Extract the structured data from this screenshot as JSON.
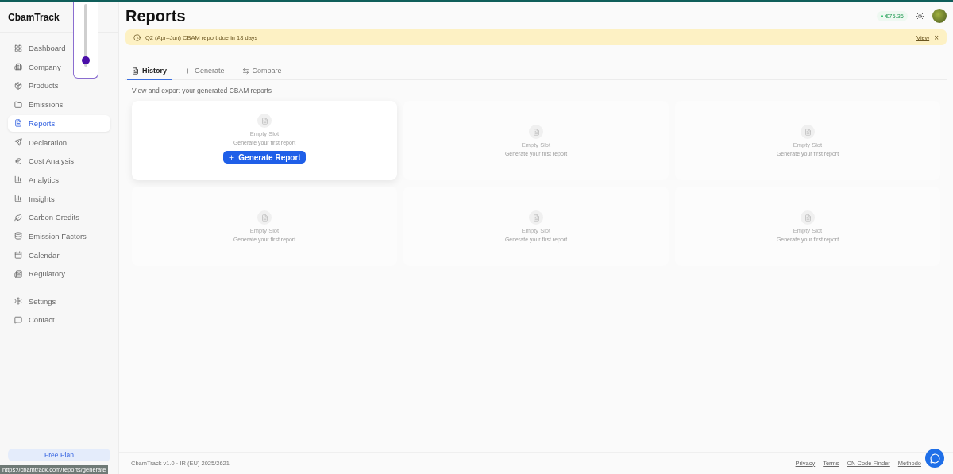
{
  "sidebar": {
    "brand": "CbamTrack",
    "items": [
      {
        "label": "Dashboard",
        "selected": false
      },
      {
        "label": "Company",
        "selected": false
      },
      {
        "label": "Products",
        "selected": false
      },
      {
        "label": "Emissions",
        "selected": false
      },
      {
        "label": "Reports",
        "selected": true
      },
      {
        "label": "Declaration",
        "selected": false
      },
      {
        "label": "Cost Analysis",
        "selected": false
      },
      {
        "label": "Analytics",
        "selected": false
      },
      {
        "label": "Insights",
        "selected": false
      },
      {
        "label": "Carbon Credits",
        "selected": false
      },
      {
        "label": "Emission Factors",
        "selected": false
      },
      {
        "label": "Calendar",
        "selected": false
      },
      {
        "label": "Regulatory",
        "selected": false
      }
    ],
    "bottom_items": [
      {
        "label": "Settings",
        "selected": false
      },
      {
        "label": "Contact",
        "selected": false
      }
    ],
    "plan_button": "Free Plan"
  },
  "overlay_slider": {
    "level": 0.1
  },
  "header": {
    "title": "Reports",
    "balance": "€75.36"
  },
  "banner": {
    "text": "Q2 (Apr–Jun) CBAM report due in 18 days",
    "link": "View",
    "close": "×"
  },
  "tabs": [
    {
      "label": "History",
      "selected": true
    },
    {
      "label": "Generate",
      "selected": false
    },
    {
      "label": "Compare",
      "selected": false
    }
  ],
  "subtitle": "View and export your generated CBAM reports",
  "slots": [
    {
      "title": "Empty Slot",
      "hint": "Generate your first report",
      "hovered": true,
      "button": "Generate Report"
    },
    {
      "title": "Empty Slot",
      "hint": "Generate your first report",
      "hovered": false
    },
    {
      "title": "Empty Slot",
      "hint": "Generate your first report",
      "hovered": false
    },
    {
      "title": "Empty Slot",
      "hint": "Generate your first report",
      "hovered": false
    },
    {
      "title": "Empty Slot",
      "hint": "Generate your first report",
      "hovered": false
    },
    {
      "title": "Empty Slot",
      "hint": "Generate your first report",
      "hovered": false
    }
  ],
  "footer": {
    "text": "CbamTrack v1.0 · IR (EU) 2025/2621",
    "links": [
      "Privacy",
      "Terms",
      "CN Code Finder",
      "Methodo"
    ]
  },
  "status_url": "https://cbamtrack.com/reports/generate"
}
